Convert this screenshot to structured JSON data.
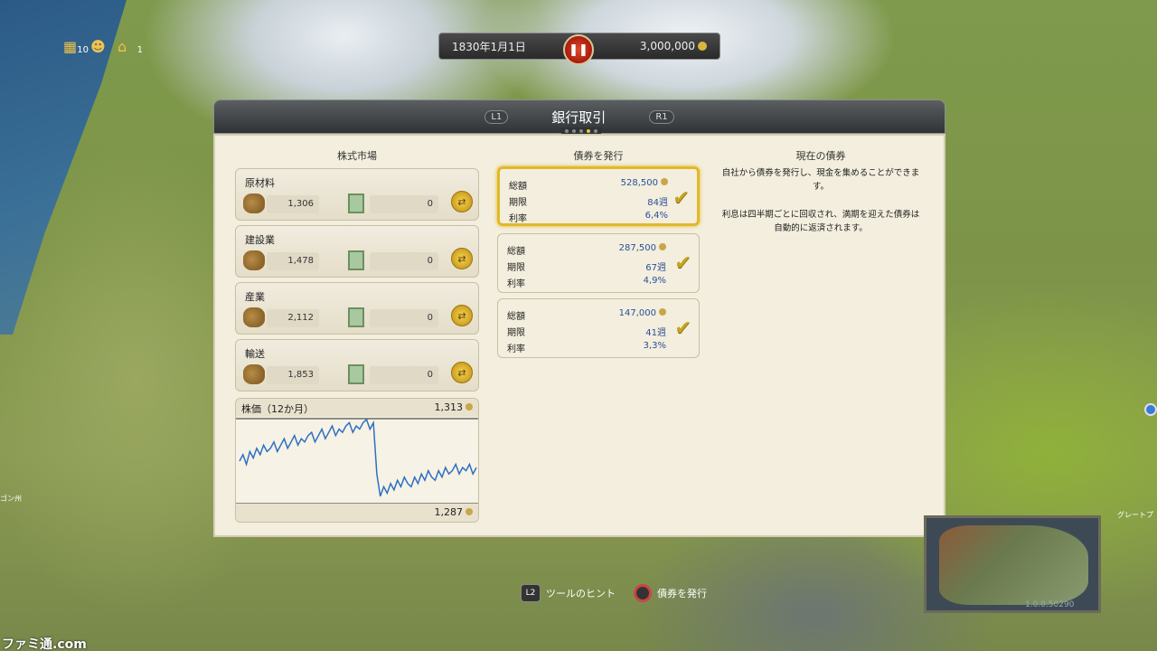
{
  "hud": {
    "date": "1830年1月1日",
    "money": "3,000,000",
    "icon_counts": [
      "10",
      "",
      "1"
    ]
  },
  "window": {
    "title": "銀行取引",
    "left_shoulder": "L1",
    "right_shoulder": "R1"
  },
  "stock_market": {
    "title": "株式市場",
    "sectors": [
      {
        "name": "原材料",
        "value": "1,306",
        "owned": "0"
      },
      {
        "name": "建設業",
        "value": "1,478",
        "owned": "0"
      },
      {
        "name": "産業",
        "value": "2,112",
        "owned": "0"
      },
      {
        "name": "輸送",
        "value": "1,853",
        "owned": "0"
      }
    ]
  },
  "chart": {
    "title": "株価（12か月）",
    "max_label": "1,313",
    "min_label": "1,287"
  },
  "chart_data": {
    "type": "line",
    "title": "株価（12か月）",
    "ylim": [
      1287,
      1313
    ],
    "grid": false,
    "series": [
      {
        "values": [
          1300,
          1302,
          1299,
          1303,
          1301,
          1304,
          1302,
          1305,
          1303,
          1304,
          1306,
          1303,
          1305,
          1307,
          1304,
          1306,
          1308,
          1305,
          1307,
          1306,
          1308,
          1309,
          1306,
          1308,
          1310,
          1307,
          1309,
          1311,
          1308,
          1310,
          1309,
          1311,
          1312,
          1309,
          1311,
          1310,
          1312,
          1313,
          1310,
          1312,
          1296,
          1289,
          1292,
          1290,
          1293,
          1291,
          1294,
          1292,
          1295,
          1293,
          1292,
          1295,
          1293,
          1296,
          1294,
          1297,
          1295,
          1294,
          1297,
          1295,
          1298,
          1296,
          1297,
          1299,
          1296,
          1298,
          1297,
          1299,
          1296,
          1298
        ]
      }
    ]
  },
  "bonds": {
    "title": "債券を発行",
    "labels": {
      "total": "総額",
      "term": "期限",
      "rate": "利率"
    },
    "items": [
      {
        "total": "528,500",
        "term": "84週",
        "rate": "6,4%",
        "selected": true
      },
      {
        "total": "287,500",
        "term": "67週",
        "rate": "4,9%",
        "selected": false
      },
      {
        "total": "147,000",
        "term": "41週",
        "rate": "3,3%",
        "selected": false
      }
    ]
  },
  "current_bonds": {
    "title": "現在の債券",
    "desc1": "自社から債券を発行し、現金を集めることができます。",
    "desc2": "利息は四半期ごとに回収され、満期を迎えた債券は自動的に返済されます。"
  },
  "bottom_hints": {
    "l2_label": "L2",
    "tool_hint": "ツールのヒント",
    "issue_bond": "債券を発行"
  },
  "minimap": {
    "label": "グレートプ",
    "version": "1.0.0.50290"
  },
  "map_label_left": "ゴン州",
  "watermark": "ファミ通.com"
}
